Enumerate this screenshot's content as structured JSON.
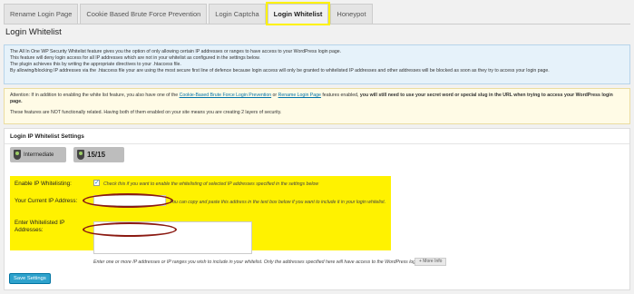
{
  "tabs": [
    {
      "label": "Rename Login Page",
      "active": false
    },
    {
      "label": "Cookie Based Brute Force Prevention",
      "active": false
    },
    {
      "label": "Login Captcha",
      "active": false
    },
    {
      "label": "Login Whitelist",
      "active": true
    },
    {
      "label": "Honeypot",
      "active": false
    }
  ],
  "page_title": "Login Whitelist",
  "info": {
    "line1": "The All In One WP Security Whitelist feature gives you the option of only allowing certain IP addresses or ranges to have access to your WordPress login page.",
    "line2": "This feature will deny login access for all IP addresses which are not in your whitelist as configured in the settings below.",
    "line3": "The plugin achieves this by writing the appropriate directives to your .htaccess file.",
    "line4": "By allowing/blocking IP addresses via the .htaccess file your are using the most secure first line of defence because login access will only be granted to whitelisted IP addresses and other addresses will be blocked as soon as they try to access your login page."
  },
  "warning": {
    "p1_a": "Attention: If in addition to enabling the white list feature, you also have one of the ",
    "link1": "Cookie-Based Brute Force Login Prevention",
    "p1_b": " or ",
    "link2": "Rename Login Page",
    "p1_c": " features enabled, ",
    "p1_strong": "you will still need to use your secret word or special slug in the URL when trying to access your WordPress login page.",
    "p2": "These features are NOT functionally related. Having both of them enabled on your site means you are creating 2 layers of security."
  },
  "settings": {
    "title": "Login IP Whitelist Settings",
    "badge_level": "Intermediate",
    "badge_points": "15/15",
    "enable_label": "Enable IP Whitelisting:",
    "enable_checked": true,
    "enable_desc": "Check this if you want to enable the whitelisting of selected IP addresses specified in the settings below",
    "current_ip_label": "Your Current IP Address:",
    "current_ip_desc": "You can copy and paste this address in the text box below if you want to include it in your login whitelist.",
    "whitelist_label": "Enter Whitelisted IP Addresses:",
    "whitelist_desc": "Enter one or more IP addresses or IP ranges you wish to include in your whitelist. Only the addresses specified here will have access to the WordPress login page.",
    "more_info": "+ More Info",
    "save_button": "Save Settings"
  },
  "colors": {
    "highlight": "#fff200",
    "annotation_circle": "#8b1a12",
    "primary_button": "#2ea2cc",
    "link": "#0073aa"
  }
}
